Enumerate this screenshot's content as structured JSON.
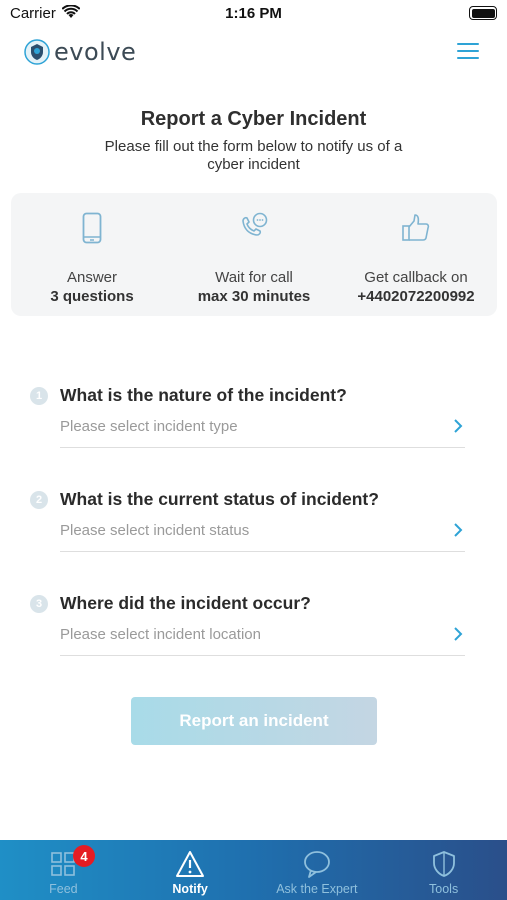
{
  "status_bar": {
    "carrier": "Carrier",
    "time": "1:16 PM",
    "wifi_icon": "wifi-icon",
    "battery_icon": "battery-icon"
  },
  "header": {
    "logo_text": "evolve",
    "logo_icon": "evolve-logo-icon",
    "menu_icon": "hamburger-menu-icon"
  },
  "page": {
    "title": "Report a Cyber Incident",
    "subtitle": "Please fill out the form below to notify us of a cyber incident"
  },
  "steps": [
    {
      "icon": "mobile-phone-icon",
      "label": "Answer",
      "value": "3 questions"
    },
    {
      "icon": "phone-call-icon",
      "label": "Wait for call",
      "value": "max 30 minutes"
    },
    {
      "icon": "thumbs-up-icon",
      "label": "Get callback on",
      "value": "+4402072200992"
    }
  ],
  "questions": [
    {
      "number": "1",
      "title": "What is the nature of the incident?",
      "placeholder": "Please select incident type"
    },
    {
      "number": "2",
      "title": "What is the current status of incident?",
      "placeholder": "Please select incident status"
    },
    {
      "number": "3",
      "title": "Where did the incident occur?",
      "placeholder": "Please select incident location"
    }
  ],
  "submit": {
    "label": "Report an incident"
  },
  "tabs": [
    {
      "label": "Feed",
      "icon": "grid-icon",
      "badge": "4",
      "active": false
    },
    {
      "label": "Notify",
      "icon": "warning-icon",
      "active": true
    },
    {
      "label": "Ask the Expert",
      "icon": "chat-bubble-icon",
      "active": false
    },
    {
      "label": "Tools",
      "icon": "shield-icon",
      "active": false
    }
  ],
  "colors": {
    "accent": "#2ea3d6",
    "tab_bar_start": "#1f8fc6",
    "tab_bar_end": "#2a4f8a",
    "badge": "#e51c23",
    "submit_disabled": "#a8dbe8"
  }
}
